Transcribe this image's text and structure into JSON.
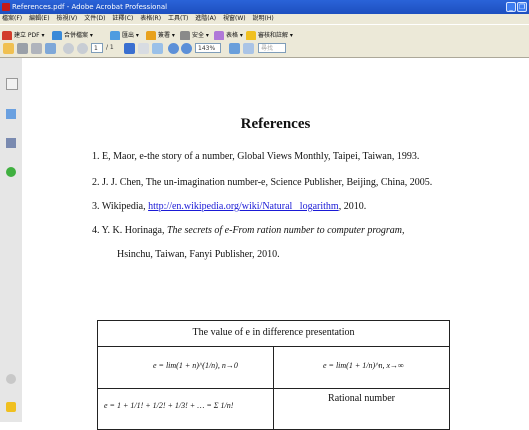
{
  "window": {
    "title": "References.pdf - Adobe Acrobat Professional"
  },
  "menubar": {
    "items": [
      "檔案(F)",
      "編輯(E)",
      "檢視(V)",
      "文件(D)",
      "註釋(C)",
      "表格(R)",
      "工具(T)",
      "進階(A)",
      "視窗(W)",
      "說明(H)"
    ]
  },
  "toolbar1": {
    "items": [
      {
        "label": "建立 PDF ▾",
        "icon": "create-pdf-icon"
      },
      {
        "label": "合併檔案 ▾",
        "icon": "combine-files-icon"
      },
      {
        "label": "匯出 ▾",
        "icon": "export-icon"
      },
      {
        "label": "簽署 ▾",
        "icon": "sign-icon"
      },
      {
        "label": "安全 ▾",
        "icon": "secure-icon"
      },
      {
        "label": "表格 ▾",
        "icon": "forms-icon"
      },
      {
        "label": "審核和註解 ▾",
        "icon": "review-comment-icon"
      }
    ]
  },
  "toolbar2": {
    "page_number": "1",
    "page_total": "/ 1",
    "zoom": "143%",
    "find_placeholder": "尋找"
  },
  "document": {
    "heading": "References",
    "references": [
      {
        "text": "1. E, Maor, e-the story of a number, Global Views Monthly, Taipei, Taiwan, 1993."
      },
      {
        "text": "2. J. J. Chen, The un-imagination number-e, Science Publisher, Beijing, China, 2005."
      },
      {
        "prefix": "3. Wikipedia, ",
        "link": "http://en.wikipedia.org/wiki/Natural _logarithm",
        "suffix": ", 2010."
      },
      {
        "prefix": "4.  Y.  K.  Horinaga,  ",
        "italic": "The secrets of e-From ration number to computer program,",
        "line2": "Hsinchu, Taiwan, Fanyi Publisher, 2010."
      }
    ],
    "table": {
      "caption": "The value of e in difference presentation",
      "row2_left": "e = lim(1 + n)^(1/n), n→0",
      "row2_right": "e = lim(1 + 1/n)^n, x→∞",
      "row3_left": "e = 1 + 1/1! + 1/2! + 1/3! + … = Σ 1/n!",
      "row3_right": "Rational number"
    }
  },
  "colors": {
    "titlebar": "#2a63d8",
    "chrome": "#ece9d8",
    "link": "#1a1ad6"
  }
}
